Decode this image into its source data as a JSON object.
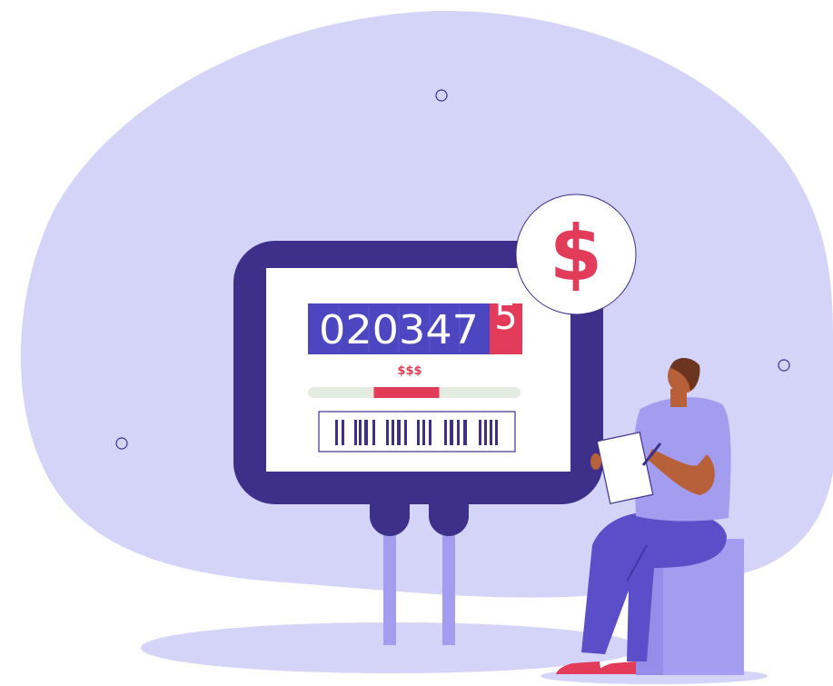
{
  "meter": {
    "reading_digits": "020347",
    "rolling_digit": "5",
    "price_label": "$$$",
    "usage_level": 0.31
  },
  "badge": {
    "symbol": "$"
  },
  "icons": {
    "dollar_badge": "dollar-icon",
    "barcode": "barcode-icon"
  },
  "colors": {
    "background_blob": "#d4d4f8",
    "meter_frame": "#3d2f8a",
    "counter_blue": "#4c47c0",
    "accent_red": "#e33b5a",
    "track_green": "#e3ebe0",
    "legs": "#a39df0",
    "person_shirt": "#a39df0",
    "person_pants": "#5a4fc8",
    "skin": "#b7603a",
    "stool": "#a39df0"
  }
}
